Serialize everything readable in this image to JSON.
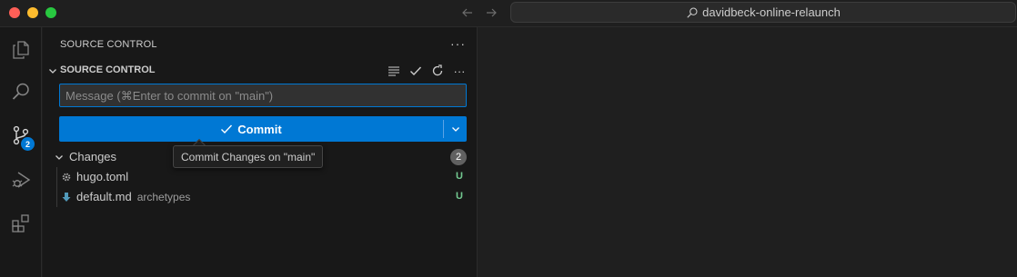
{
  "titlebar": {
    "search_text": "davidbeck-online-relaunch",
    "icons": [
      "back-arrow-icon",
      "forward-arrow-icon",
      "search-icon"
    ]
  },
  "activity_bar": {
    "items": [
      "explorer-icon",
      "search-icon",
      "source-control-icon",
      "run-debug-icon",
      "extensions-icon"
    ],
    "scm_badge": "2"
  },
  "sidebar": {
    "title": "SOURCE CONTROL",
    "section_title": "SOURCE CONTROL",
    "message_placeholder": "Message (⌘Enter to commit on \"main\")",
    "message_value": "",
    "commit_label": "Commit",
    "tooltip": "Commit Changes on \"main\"",
    "changes_label": "Changes",
    "changes_count": "2",
    "files": [
      {
        "name": "hugo.toml",
        "dir": "",
        "status": "U",
        "icon": "gear-icon"
      },
      {
        "name": "default.md",
        "dir": "archetypes",
        "status": "U",
        "icon": "markdown-icon"
      }
    ]
  },
  "colors": {
    "accent": "#0078d4",
    "untracked": "#73c991",
    "background": "#1e1e1e",
    "sidebar": "#181818"
  }
}
